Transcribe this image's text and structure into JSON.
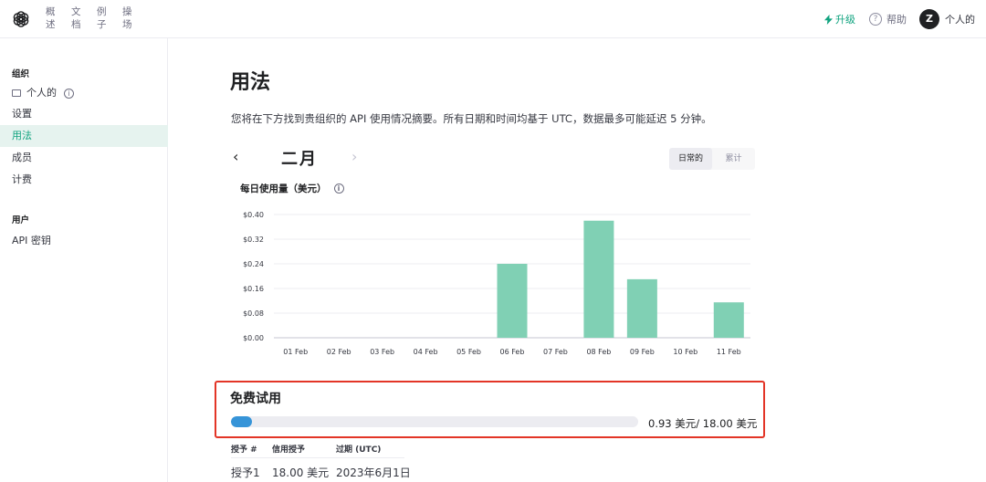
{
  "nav": {
    "items": [
      "概述",
      "文档",
      "例子",
      "操场"
    ]
  },
  "header": {
    "upgrade_label": "升级",
    "help_label": "帮助",
    "avatar_letter": "Z",
    "user_label": "个人的"
  },
  "sidebar": {
    "org_heading": "组织",
    "org_items": [
      {
        "label": "个人的"
      },
      {
        "label": "设置"
      },
      {
        "label": "用法"
      },
      {
        "label": "成员"
      },
      {
        "label": "计费"
      }
    ],
    "user_heading": "用户",
    "user_items": [
      {
        "label": "API 密钥"
      }
    ]
  },
  "main": {
    "title": "用法",
    "description": "您将在下方找到贵组织的 API 使用情况摘要。所有日期和时间均基于 UTC，数据最多可能延迟 5 分钟。",
    "month": "二月",
    "toggle": {
      "daily": "日常的",
      "cumulative": "累计"
    }
  },
  "chart_data": {
    "type": "bar",
    "title": "每日使用量（美元）",
    "categories": [
      "01 Feb",
      "02 Feb",
      "03 Feb",
      "04 Feb",
      "05 Feb",
      "06 Feb",
      "07 Feb",
      "08 Feb",
      "09 Feb",
      "10 Feb",
      "11 Feb"
    ],
    "values": [
      0,
      0,
      0,
      0,
      0,
      0.24,
      0,
      0.38,
      0.19,
      0,
      0.115
    ],
    "yticks": [
      "$0.00",
      "$0.08",
      "$0.16",
      "$0.24",
      "$0.32",
      "$0.40"
    ],
    "ylim": [
      0,
      0.4
    ],
    "color": "#80d0b4",
    "grid": true
  },
  "free_trial": {
    "title": "免费试用",
    "used_fraction": 0.052,
    "amount_text": "0.93 美元/ 18.00 美元",
    "bar_color": "#3694d8"
  },
  "grants": {
    "headers": [
      "授予 #",
      "信用授予",
      "过期 (UTC)"
    ],
    "rows": [
      [
        "授予1",
        "18.00 美元",
        "2023年6月1日"
      ]
    ]
  }
}
